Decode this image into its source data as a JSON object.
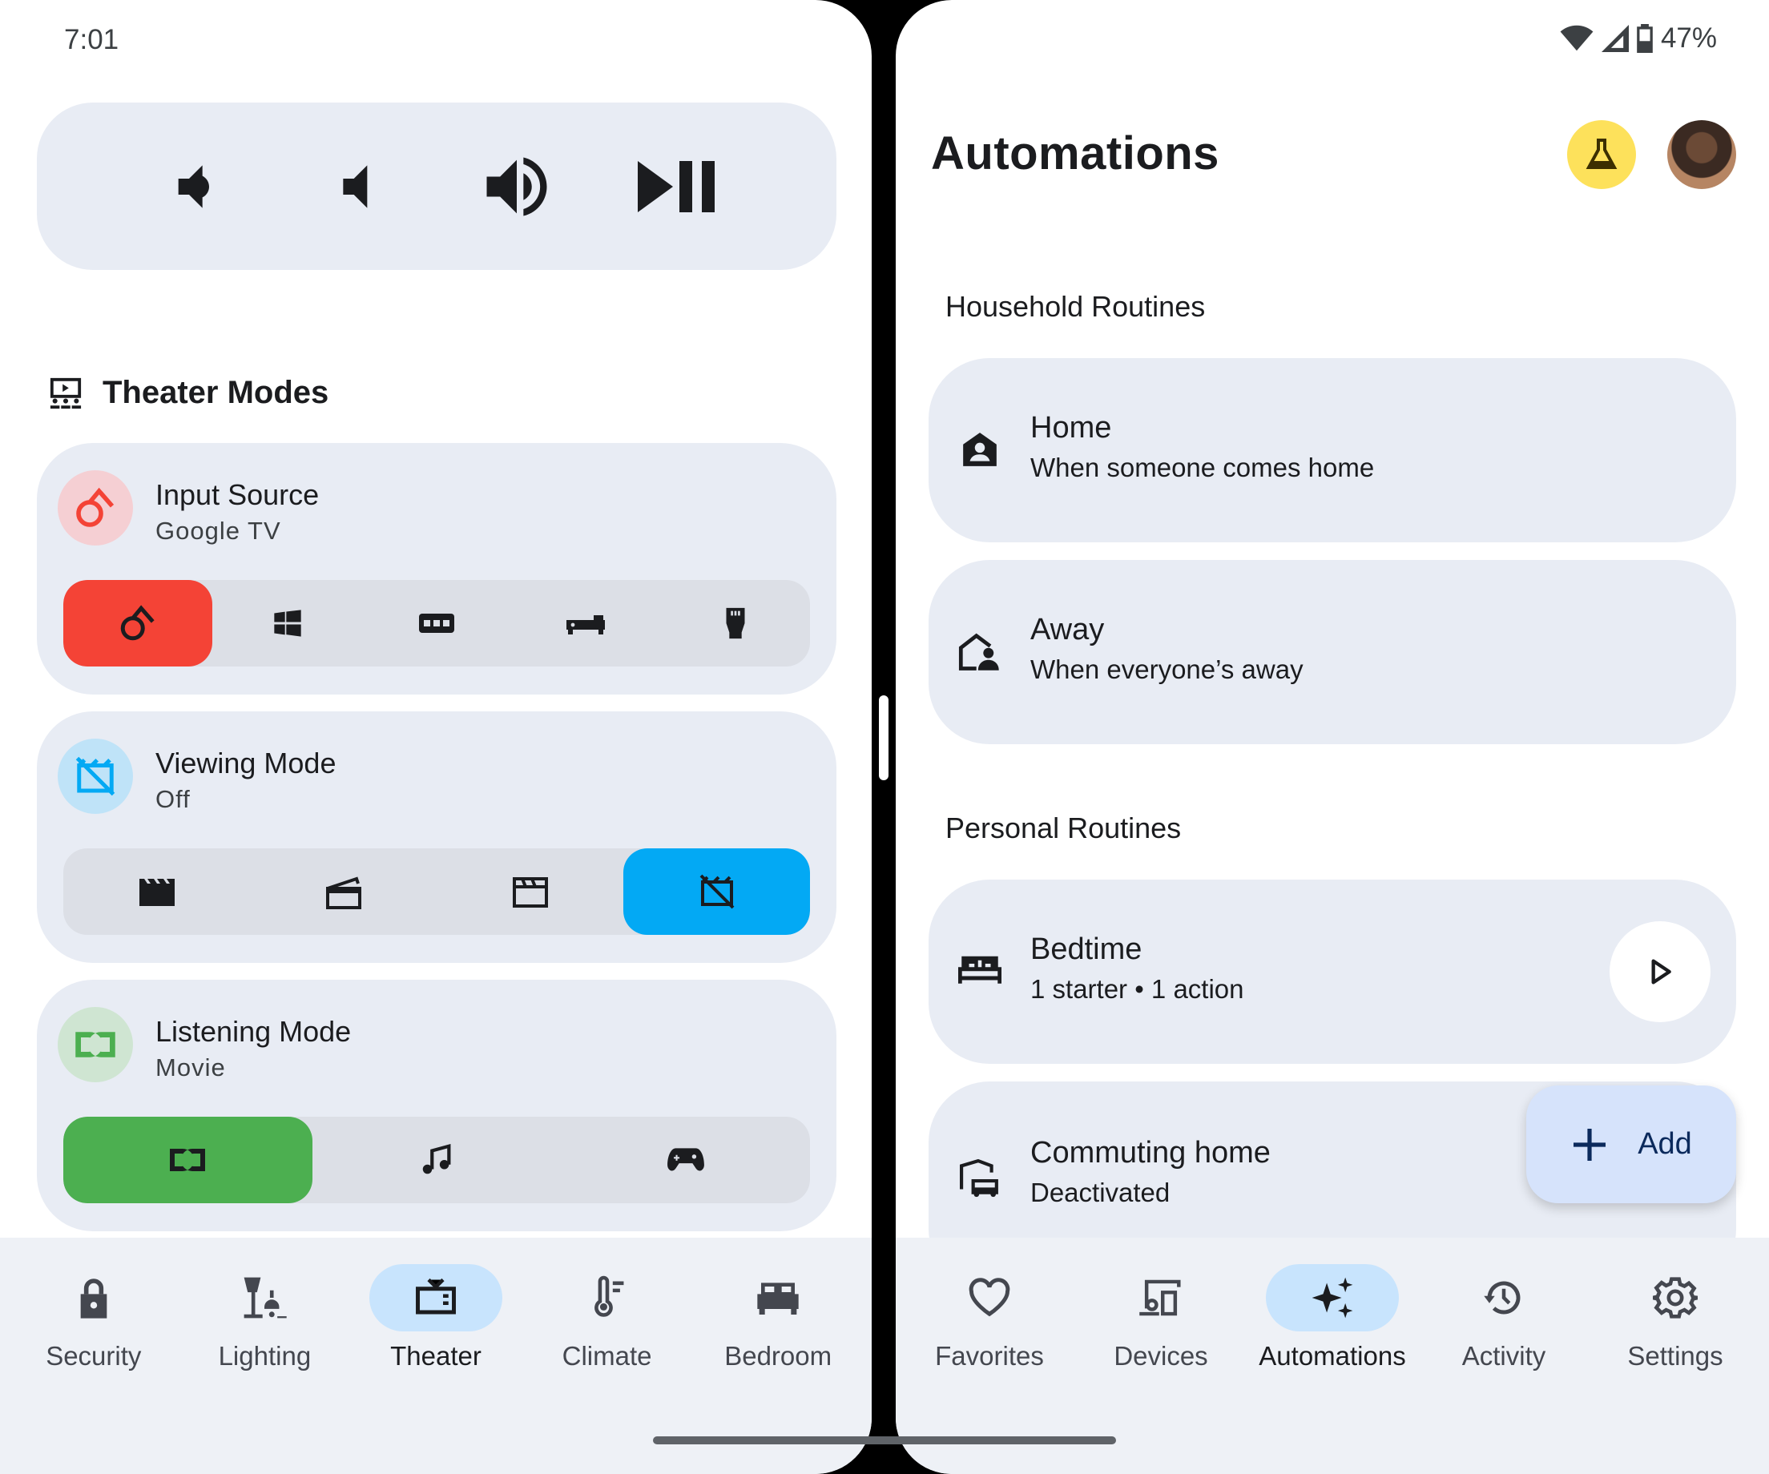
{
  "status_bar": {
    "time": "7:01",
    "battery": "47%"
  },
  "media_controls": {
    "buttons": [
      "volume-down",
      "mute",
      "volume-up",
      "play-pause"
    ]
  },
  "theater_modes": {
    "title": "Theater Modes",
    "input_source": {
      "title": "Input Source",
      "value": "Google TV",
      "accent": "#f44336",
      "options": [
        "google-tv",
        "windows-pc",
        "vcr",
        "receiver",
        "hdmi"
      ],
      "selected_index": 0
    },
    "viewing_mode": {
      "title": "Viewing Mode",
      "value": "Off",
      "accent": "#03a9f4",
      "options": [
        "movie",
        "movie-open",
        "movie-outline",
        "movie-off"
      ],
      "selected_index": 3
    },
    "listening_mode": {
      "title": "Listening Mode",
      "value": "Movie",
      "accent": "#4caf50",
      "options": [
        "dolby-movie",
        "music",
        "gaming"
      ],
      "selected_index": 0
    }
  },
  "left_nav": {
    "items": [
      {
        "label": "Security",
        "icon": "lock-icon"
      },
      {
        "label": "Lighting",
        "icon": "lamp-icon"
      },
      {
        "label": "Theater",
        "icon": "tv-icon",
        "active": true
      },
      {
        "label": "Climate",
        "icon": "thermometer-icon"
      },
      {
        "label": "Bedroom",
        "icon": "bed-icon"
      }
    ]
  },
  "automations": {
    "title": "Automations",
    "household": {
      "title": "Household Routines",
      "items": [
        {
          "title": "Home",
          "subtitle": "When someone comes home",
          "icon": "home-person-icon"
        },
        {
          "title": "Away",
          "subtitle": "When everyone’s away",
          "icon": "away-icon"
        }
      ]
    },
    "personal": {
      "title": "Personal Routines",
      "items": [
        {
          "title": "Bedtime",
          "subtitle": "1 starter • 1 action",
          "icon": "bed-icon"
        },
        {
          "title": "Commuting home",
          "subtitle": "Deactivated",
          "icon": "commute-icon"
        }
      ]
    },
    "fab_label": "Add"
  },
  "right_nav": {
    "items": [
      {
        "label": "Favorites",
        "icon": "heart-icon"
      },
      {
        "label": "Devices",
        "icon": "devices-icon"
      },
      {
        "label": "Automations",
        "icon": "sparkle-icon",
        "active": true
      },
      {
        "label": "Activity",
        "icon": "history-icon"
      },
      {
        "label": "Settings",
        "icon": "gear-icon"
      }
    ]
  }
}
